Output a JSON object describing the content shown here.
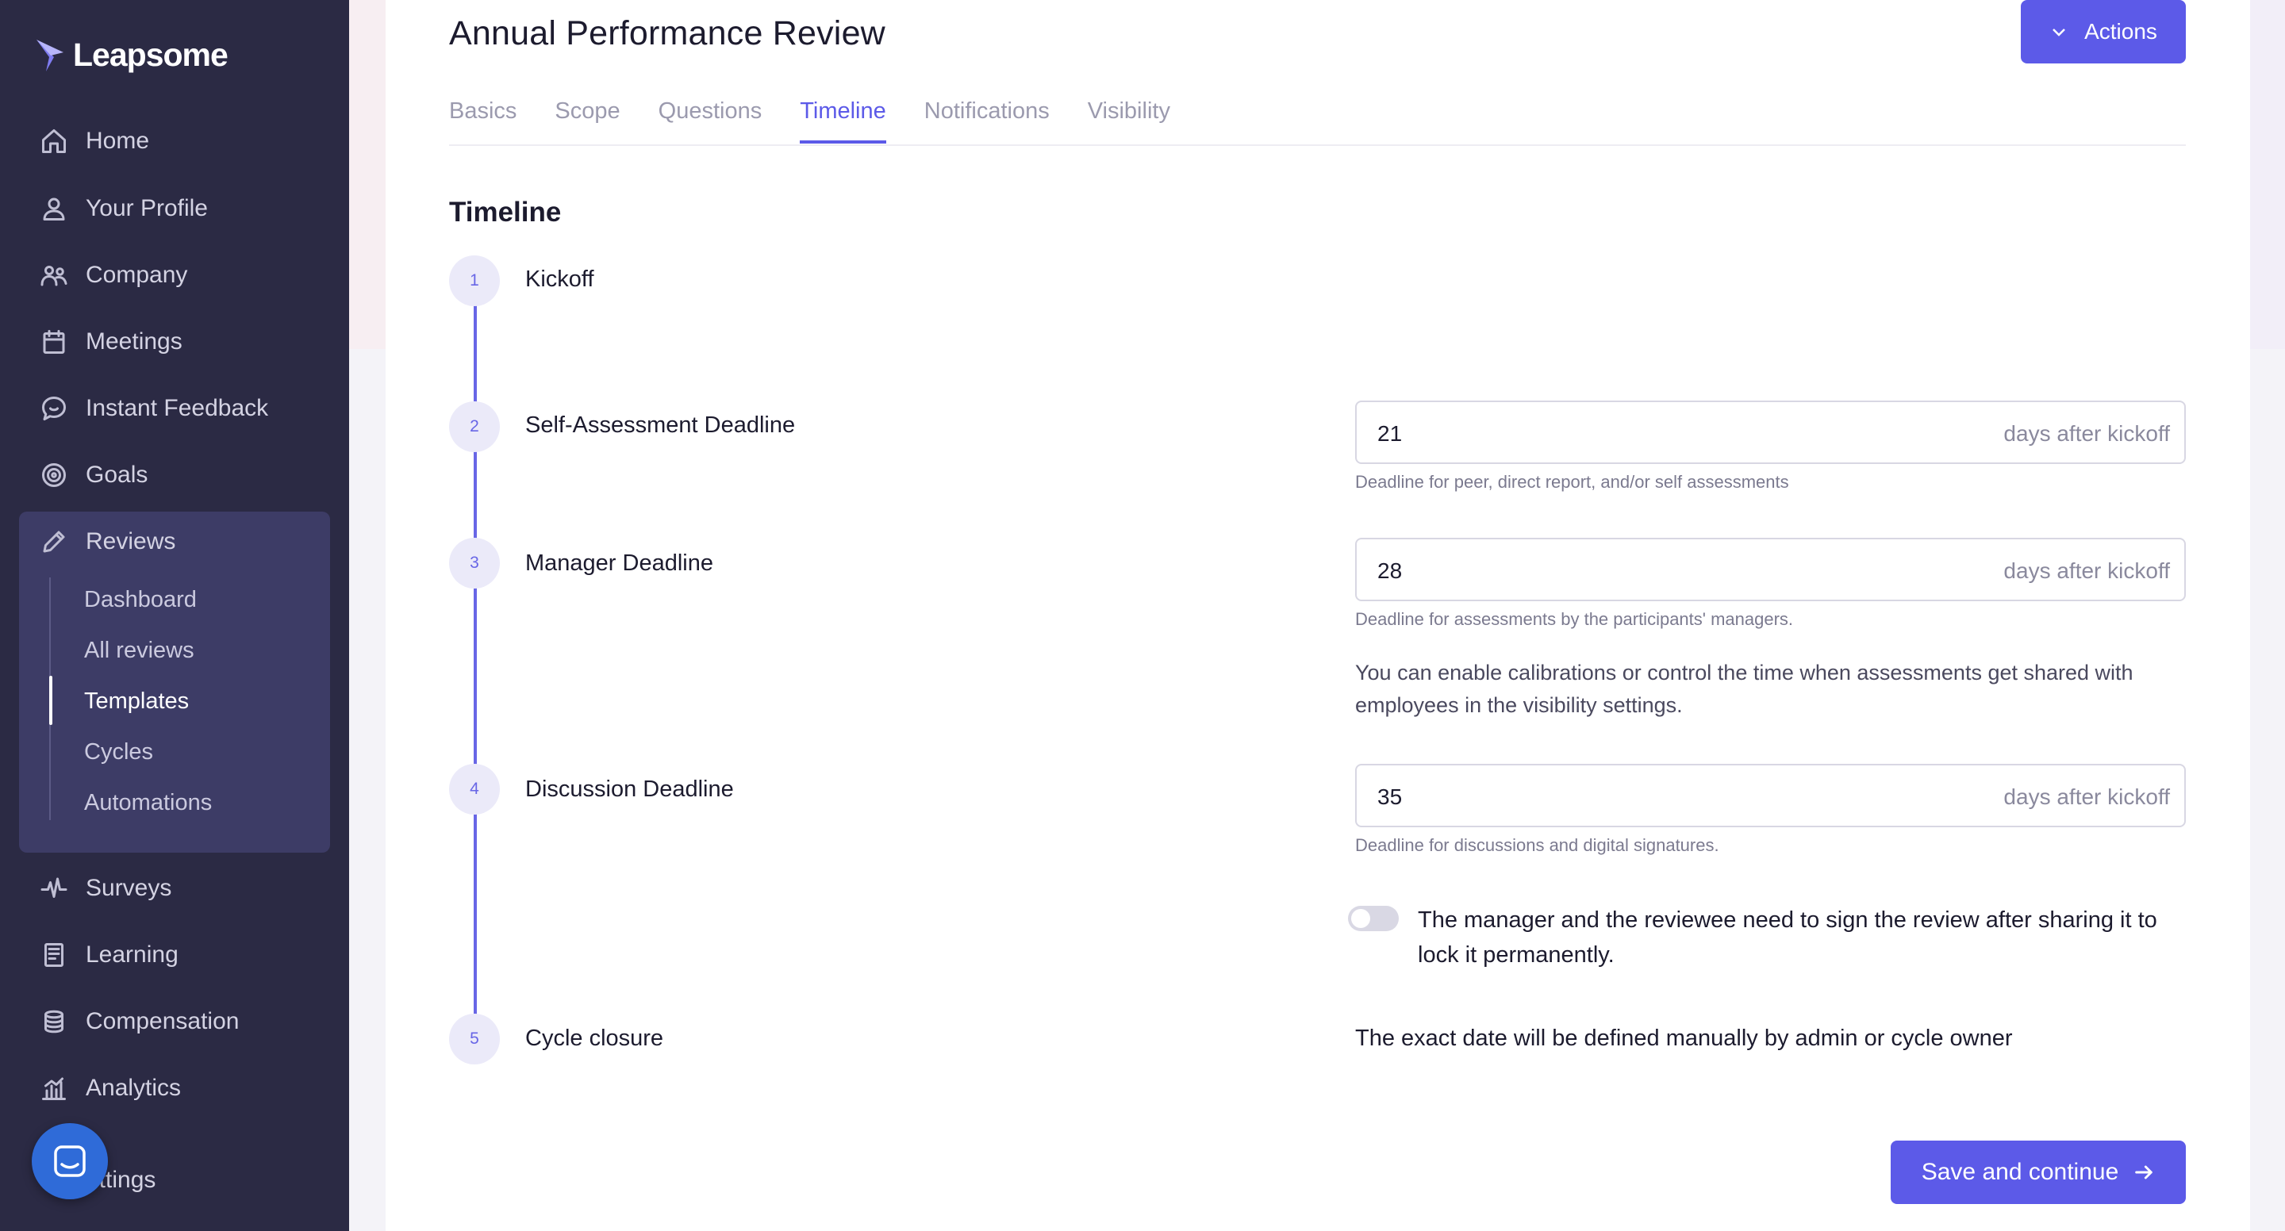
{
  "brand": {
    "name": "Leapsome"
  },
  "sidebar": {
    "items": [
      {
        "label": "Home",
        "icon": "home-icon"
      },
      {
        "label": "Your Profile",
        "icon": "user-icon"
      },
      {
        "label": "Company",
        "icon": "users-icon"
      },
      {
        "label": "Meetings",
        "icon": "calendar-icon"
      },
      {
        "label": "Instant Feedback",
        "icon": "chat-icon"
      },
      {
        "label": "Goals",
        "icon": "target-icon"
      },
      {
        "label": "Reviews",
        "icon": "pencil-icon"
      },
      {
        "label": "Surveys",
        "icon": "pulse-icon"
      },
      {
        "label": "Learning",
        "icon": "book-icon"
      },
      {
        "label": "Compensation",
        "icon": "coins-icon"
      },
      {
        "label": "Analytics",
        "icon": "chart-icon"
      },
      {
        "label": "ettings",
        "icon": "gear-icon"
      }
    ],
    "reviews_sub": [
      "Dashboard",
      "All reviews",
      "Templates",
      "Cycles",
      "Automations"
    ],
    "active_sub": "Templates"
  },
  "header": {
    "title": "Annual Performance Review",
    "actions_label": "Actions"
  },
  "tabs": [
    "Basics",
    "Scope",
    "Questions",
    "Timeline",
    "Notifications",
    "Visibility"
  ],
  "active_tab": "Timeline",
  "timeline": {
    "title": "Timeline",
    "steps": [
      {
        "number": "1",
        "label": "Kickoff"
      },
      {
        "number": "2",
        "label": "Self-Assessment Deadline",
        "days": "21",
        "suffix": "days after kickoff",
        "helper": "Deadline for peer, direct report, and/or self assessments"
      },
      {
        "number": "3",
        "label": "Manager Deadline",
        "days": "28",
        "suffix": "days after kickoff",
        "helper": "Deadline for assessments by the participants' managers.",
        "note": "You can enable calibrations or control the time when assessments get shared with employees in the visibility settings."
      },
      {
        "number": "4",
        "label": "Discussion Deadline",
        "days": "35",
        "suffix": "days after kickoff",
        "helper": "Deadline for discussions and digital signatures.",
        "toggle_label": "The manager and the reviewee need to sign the review after sharing it to lock it permanently.",
        "toggle_on": false
      },
      {
        "number": "5",
        "label": "Cycle closure",
        "note": "The exact date will be defined manually by admin or cycle owner"
      }
    ]
  },
  "footer": {
    "save_label": "Save and continue"
  },
  "colors": {
    "accent": "#5c5ae8",
    "sidebar_bg": "#2b2a44",
    "sidebar_active_bg": "#3d3c66"
  }
}
